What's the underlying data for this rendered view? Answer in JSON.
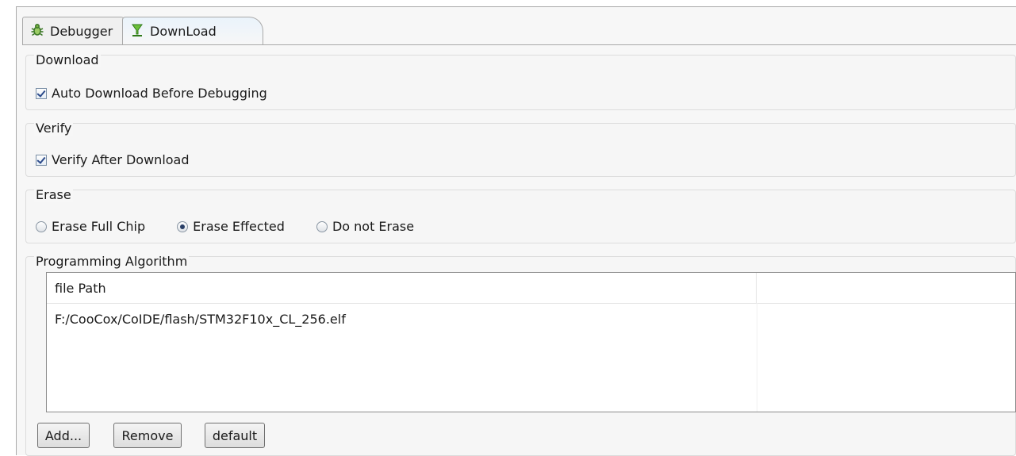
{
  "tabs": [
    {
      "label": "Debugger",
      "icon": "bug-icon"
    },
    {
      "label": "DownLoad",
      "icon": "download-icon",
      "active": true
    }
  ],
  "download": {
    "title": "Download",
    "auto_download": {
      "label": "Auto Download Before Debugging",
      "checked": true
    }
  },
  "verify": {
    "title": "Verify",
    "verify_after": {
      "label": "Verify After Download",
      "checked": true
    }
  },
  "erase": {
    "title": "Erase",
    "options": [
      {
        "label": "Erase Full Chip",
        "selected": false
      },
      {
        "label": "Erase Effected",
        "selected": true
      },
      {
        "label": "Do not Erase",
        "selected": false
      }
    ]
  },
  "programming": {
    "title": "Programming Algorithm",
    "columns": [
      "file Path",
      ""
    ],
    "rows": [
      [
        "F:/CooCox/CoIDE/flash/STM32F10x_CL_256.elf",
        ""
      ]
    ],
    "buttons": {
      "add": "Add...",
      "remove": "Remove",
      "default": "default"
    }
  }
}
